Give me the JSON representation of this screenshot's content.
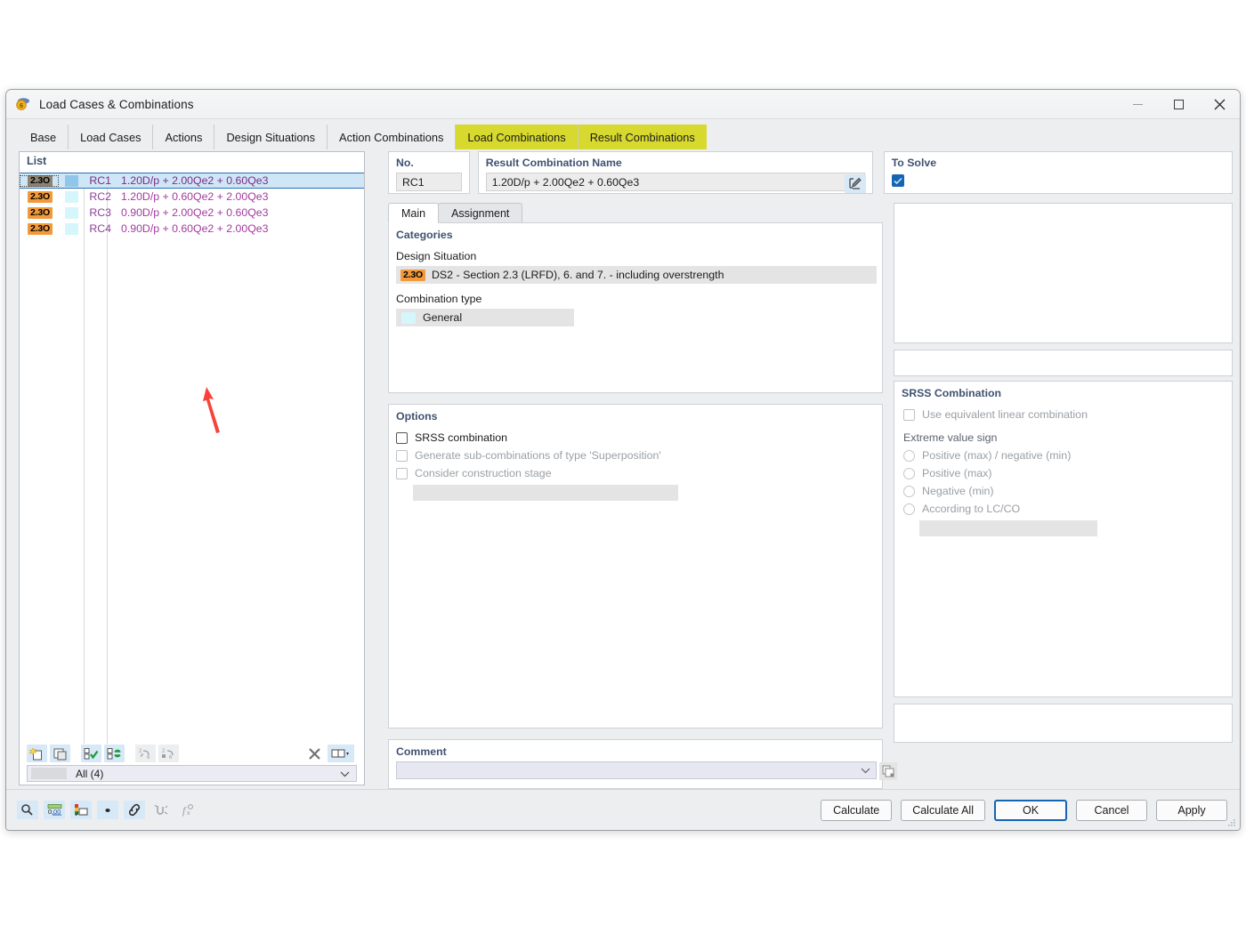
{
  "window": {
    "title": "Load Cases & Combinations",
    "app_icon": "rfem-logo-icon",
    "minimize": "minimize-icon",
    "maximize": "maximize-icon",
    "close": "close-icon"
  },
  "tabs": [
    {
      "label": "Base",
      "highlighted": false
    },
    {
      "label": "Load Cases",
      "highlighted": false
    },
    {
      "label": "Actions",
      "highlighted": false
    },
    {
      "label": "Design Situations",
      "highlighted": false
    },
    {
      "label": "Action Combinations",
      "highlighted": false
    },
    {
      "label": "Load Combinations",
      "highlighted": true
    },
    {
      "label": "Result Combinations",
      "highlighted": true
    }
  ],
  "list": {
    "header": "List",
    "rows": [
      {
        "ds": "2.3O",
        "no": "RC1",
        "name": "1.20D/p + 2.00Qe2 + 0.60Qe3",
        "selected": true
      },
      {
        "ds": "2.3O",
        "no": "RC2",
        "name": "1.20D/p + 0.60Qe2 + 2.00Qe3",
        "selected": false
      },
      {
        "ds": "2.3O",
        "no": "RC3",
        "name": "0.90D/p + 2.00Qe2 + 0.60Qe3",
        "selected": false
      },
      {
        "ds": "2.3O",
        "no": "RC4",
        "name": "0.90D/p + 0.60Qe2 + 2.00Qe3",
        "selected": false
      }
    ],
    "toolbar": [
      {
        "name": "new-combination-icon",
        "enabled": true
      },
      {
        "name": "copy-combination-icon",
        "enabled": true
      },
      {
        "name": "select-all-icon",
        "enabled": true
      },
      {
        "name": "invert-selection-icon",
        "enabled": true
      },
      {
        "name": "renumber-icon",
        "enabled": false
      },
      {
        "name": "sort-icon",
        "enabled": false
      },
      {
        "name": "delete-icon",
        "enabled": true
      },
      {
        "name": "view-columns-icon",
        "enabled": true
      }
    ],
    "filter": "All (4)",
    "filter_chevron": "chevron-down-icon"
  },
  "details": {
    "no_label": "No.",
    "no_value": "RC1",
    "name_label": "Result Combination Name",
    "name_value": "1.20D/p + 2.00Qe2 + 0.60Qe3",
    "edit_icon": "edit-pencil-icon",
    "to_solve_label": "To Solve",
    "to_solve_checked": true,
    "check_icon": "check-icon"
  },
  "inner_tabs": [
    {
      "label": "Main",
      "active": true
    },
    {
      "label": "Assignment",
      "active": false
    }
  ],
  "categories": {
    "title": "Categories",
    "design_situation_label": "Design Situation",
    "design_situation_badge": "2.3O",
    "design_situation_value": "DS2 - Section 2.3 (LRFD), 6. and 7. - including overstrength",
    "combination_type_label": "Combination type",
    "combination_type_value": "General"
  },
  "options": {
    "title": "Options",
    "items": [
      {
        "label": "SRSS combination",
        "checked": false,
        "enabled": true
      },
      {
        "label": "Generate sub-combinations of type 'Superposition'",
        "checked": false,
        "enabled": false
      },
      {
        "label": "Consider construction stage",
        "checked": false,
        "enabled": false
      }
    ]
  },
  "comment": {
    "title": "Comment",
    "value": "",
    "chevron": "chevron-down-icon",
    "copy_icon": "copy-icon"
  },
  "srss": {
    "title": "SRSS Combination",
    "use_equivalent_label": "Use equivalent linear combination",
    "use_equivalent_checked": false,
    "extreme_value_label": "Extreme value sign",
    "options": [
      {
        "label": "Positive (max) / negative (min)",
        "selected": false
      },
      {
        "label": "Positive (max)",
        "selected": false
      },
      {
        "label": "Negative (min)",
        "selected": false
      },
      {
        "label": "According to LC/CO",
        "selected": false
      }
    ]
  },
  "bottombar": {
    "tools": [
      {
        "name": "units-icon",
        "enabled": true
      },
      {
        "name": "decimal-places-icon",
        "enabled": true
      },
      {
        "name": "colors-icon",
        "enabled": true
      },
      {
        "name": "dot-icon",
        "enabled": true
      },
      {
        "name": "link-icon",
        "enabled": true
      },
      {
        "name": "snap-icon",
        "enabled": false
      },
      {
        "name": "formula-icon",
        "enabled": false
      }
    ],
    "buttons": [
      {
        "label": "Calculate",
        "primary": false
      },
      {
        "label": "Calculate All",
        "primary": false
      },
      {
        "label": "OK",
        "primary": true
      },
      {
        "label": "Cancel",
        "primary": false
      },
      {
        "label": "Apply",
        "primary": false
      }
    ]
  },
  "annotation": {
    "arrow_color": "#f9423a",
    "name": "red-pointer-arrow"
  }
}
